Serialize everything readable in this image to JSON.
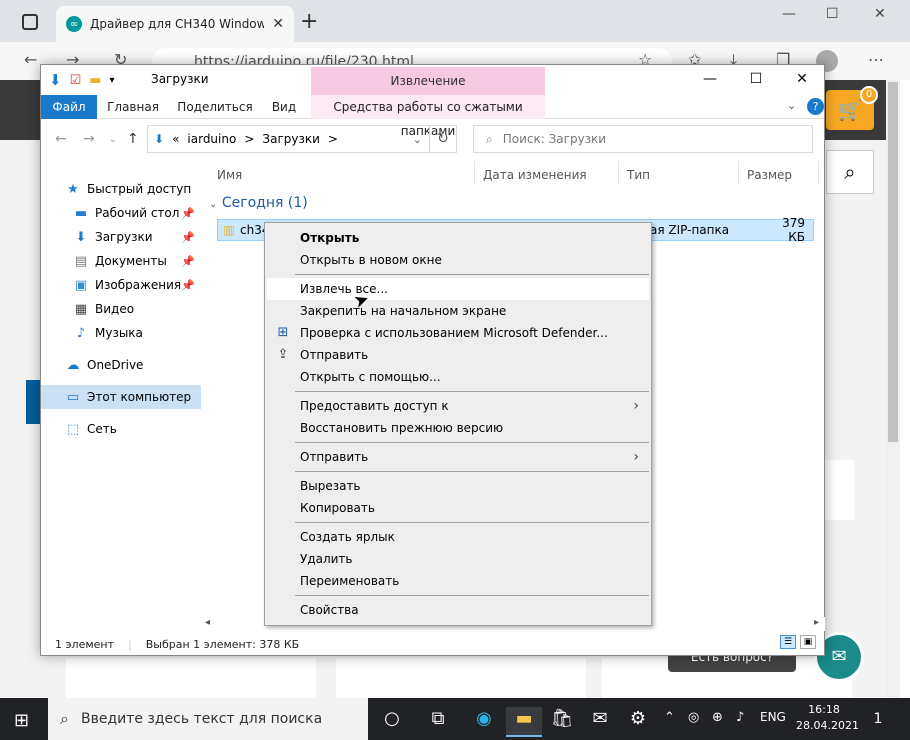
{
  "browser": {
    "tab_title": "Драйвер для CH340 Windows (Х",
    "new_tab": "+",
    "address": "https://iarduino.ru/file/230.html",
    "cart_count": "0"
  },
  "explorer": {
    "title": "Загрузки",
    "context_tab_top": "Извлечение",
    "context_tab_sub": "Средства работы со сжатыми папками",
    "ribbon_tabs": [
      "Файл",
      "Главная",
      "Поделиться",
      "Вид"
    ],
    "breadcrumb": [
      "«",
      "iarduino",
      ">",
      "Загрузки",
      ">"
    ],
    "search_placeholder": "Поиск: Загрузки",
    "nav": {
      "quick_access": "Быстрый доступ",
      "desktop": "Рабочий стол",
      "downloads": "Загрузки",
      "documents": "Документы",
      "pictures": "Изображения",
      "video": "Видео",
      "music": "Музыка",
      "onedrive": "OneDrive",
      "this_pc": "Этот компьютер",
      "network": "Сеть"
    },
    "columns": [
      "Имя",
      "Дата изменения",
      "Тип",
      "Размер"
    ],
    "group": "Сегодня (1)",
    "file": {
      "name": "ch340",
      "type": "ая ZIP-папка",
      "size": "379 КБ"
    },
    "status_count": "1 элемент",
    "status_selected": "Выбран 1 элемент: 378 КБ"
  },
  "context_menu": {
    "open": "Открыть",
    "open_new_window": "Открыть в новом окне",
    "extract_all": "Извлечь все...",
    "pin_start": "Закрепить на начальном экране",
    "defender": "Проверка с использованием Microsoft Defender...",
    "share": "Отправить",
    "open_with": "Открыть с помощью...",
    "give_access": "Предоставить доступ к",
    "restore": "Восстановить прежнюю версию",
    "send_to": "Отправить",
    "cut": "Вырезать",
    "copy": "Копировать",
    "create_shortcut": "Создать ярлык",
    "delete": "Удалить",
    "rename": "Переименовать",
    "properties": "Свойства"
  },
  "website": {
    "chat_label": "Есть вопрос?"
  },
  "taskbar": {
    "search_placeholder": "Введите здесь текст для поиска",
    "lang": "ENG",
    "time": "16:18",
    "date": "28.04.2021",
    "notif_count": "1"
  }
}
